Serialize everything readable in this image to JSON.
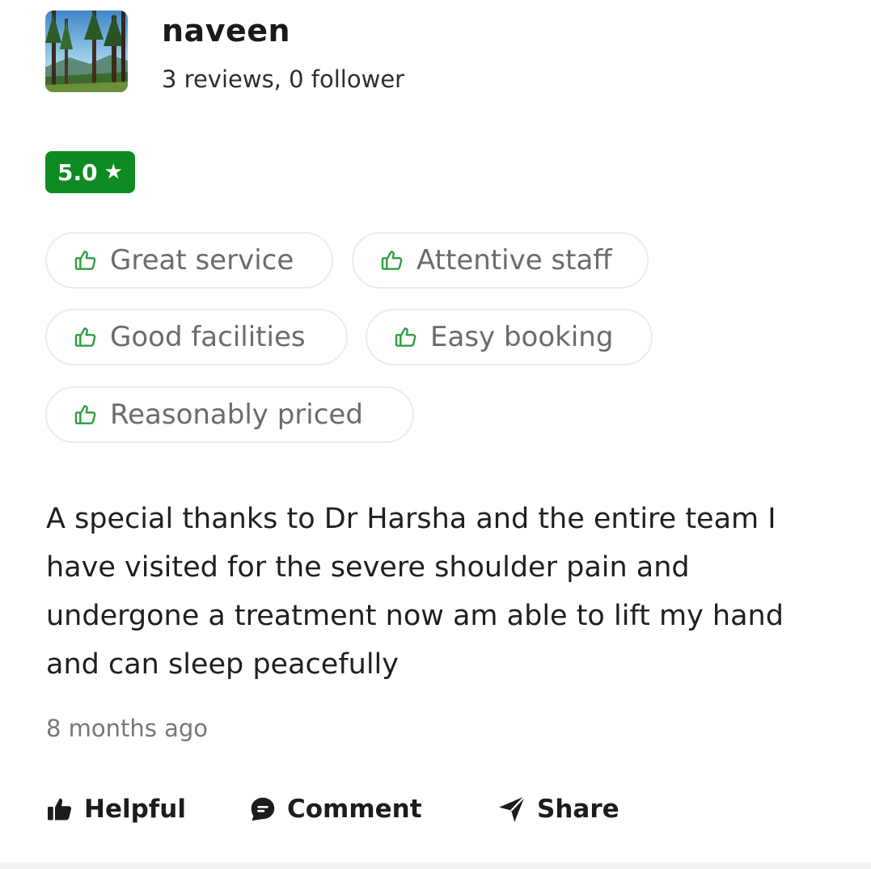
{
  "reviewer": {
    "name": "naveen",
    "stats": "3 reviews, 0 follower"
  },
  "rating": {
    "value": "5.0",
    "star": "★",
    "badge_color": "#0d8a22"
  },
  "tags": [
    {
      "label": "Great service",
      "icon": "thumbs-up-outline-icon"
    },
    {
      "label": "Attentive staff",
      "icon": "thumbs-up-outline-icon"
    },
    {
      "label": "Good facilities",
      "icon": "thumbs-up-outline-icon"
    },
    {
      "label": "Easy booking",
      "icon": "thumbs-up-outline-icon"
    },
    {
      "label": "Reasonably priced",
      "icon": "thumbs-up-outline-icon"
    }
  ],
  "review": {
    "text": "A special thanks to Dr Harsha and the entire team I have visited for the severe shoulder pain and undergone a treatment now am able to lift my hand and can sleep peacefully",
    "time": "8 months ago"
  },
  "actions": {
    "helpful": "Helpful",
    "comment": "Comment",
    "share": "Share"
  },
  "colors": {
    "accent_green": "#0d8a22",
    "tag_icon_green": "#2e9e3e"
  }
}
